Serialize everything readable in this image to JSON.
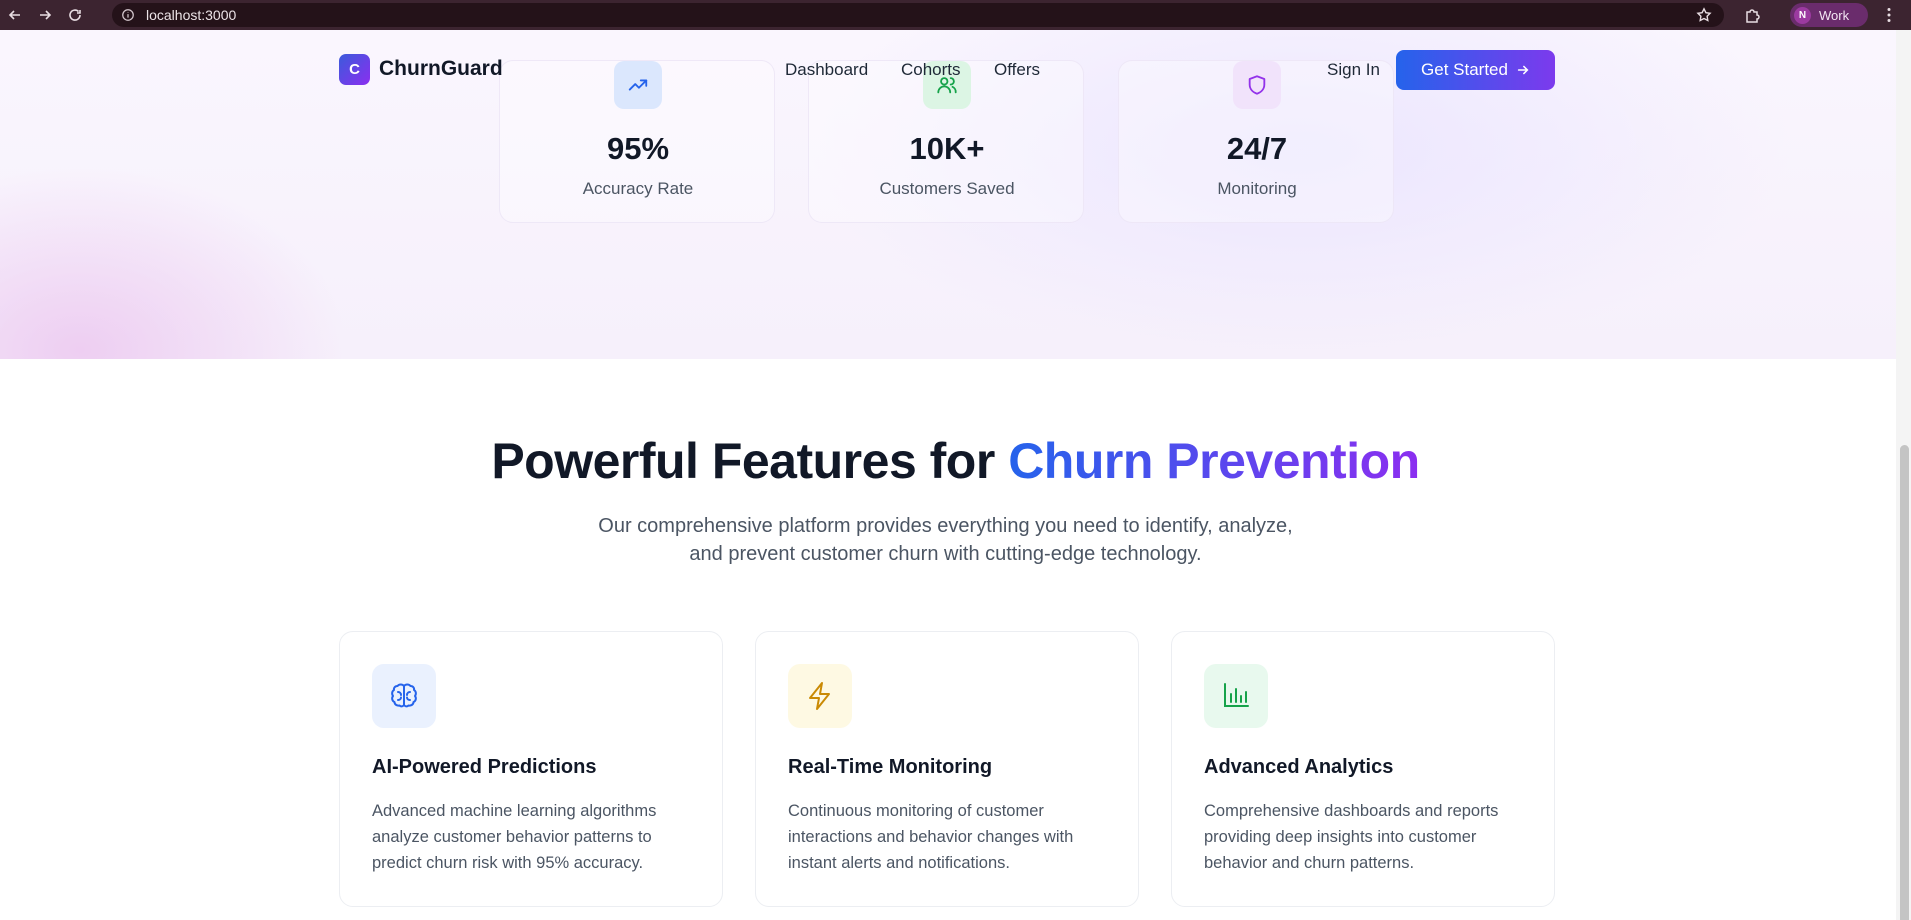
{
  "browser": {
    "url": "localhost:3000",
    "profile_initial": "N",
    "profile_name": "Work"
  },
  "navbar": {
    "logo_letter": "C",
    "brand": "ChurnGuard",
    "links": [
      "Dashboard",
      "Cohorts",
      "Offers"
    ],
    "sign_in": "Sign In",
    "cta": "Get Started"
  },
  "stats": [
    {
      "value": "95%",
      "label": "Accuracy Rate",
      "icon": "trending-up-icon",
      "color": "#2563eb",
      "bg": "#dbe7fd"
    },
    {
      "value": "10K+",
      "label": "Customers Saved",
      "icon": "users-icon",
      "color": "#16a34a",
      "bg": "#dcf5e4"
    },
    {
      "value": "24/7",
      "label": "Monitoring",
      "icon": "shield-icon",
      "color": "#9333ea",
      "bg": "#f1e3fb"
    }
  ],
  "features_section": {
    "title_plain": "Powerful Features for ",
    "title_highlight": "Churn Prevention",
    "subtitle_line1": "Our comprehensive platform provides everything you need to identify, analyze,",
    "subtitle_line2": "and prevent customer churn with cutting-edge technology."
  },
  "features": [
    {
      "title": "AI-Powered Predictions",
      "desc": "Advanced machine learning algorithms analyze customer behavior patterns to predict churn risk with 95% accuracy.",
      "icon": "brain-icon",
      "color": "#2563eb",
      "bg": "#eaf1fe"
    },
    {
      "title": "Real-Time Monitoring",
      "desc": "Continuous monitoring of customer interactions and behavior changes with instant alerts and notifications.",
      "icon": "lightning-icon",
      "color": "#ca8a04",
      "bg": "#fef9e3"
    },
    {
      "title": "Advanced Analytics",
      "desc": "Comprehensive dashboards and reports providing deep insights into customer behavior and churn patterns.",
      "icon": "bar-chart-icon",
      "color": "#16a34a",
      "bg": "#e8f9ee"
    }
  ]
}
